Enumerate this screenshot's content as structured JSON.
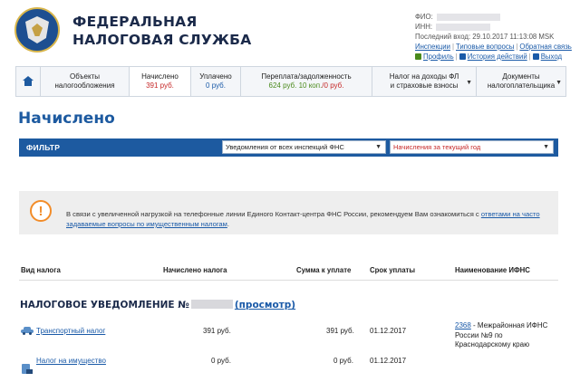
{
  "header": {
    "brand_line1": "ФЕДЕРАЛЬНАЯ",
    "brand_line2": "НАЛОГОВАЯ СЛУЖБА",
    "fio_label": "ФИО:",
    "inn_label": "ИНН:",
    "last_login": "Последний вход: 29.10.2017 11:13:08 MSK",
    "links": {
      "inspections": "Инспекции",
      "typical_questions": "Типовые вопросы",
      "feedback": "Обратная связь",
      "profile": "Профиль",
      "action_history": "История действий",
      "logout": "Выход"
    }
  },
  "tabs": [
    {
      "line1": "Объекты",
      "line2": "налогообложения"
    },
    {
      "line1": "Начислено",
      "line2": "391 руб."
    },
    {
      "line1": "Уплачено",
      "line2": "0 руб."
    },
    {
      "line1": "Переплата/задолженность",
      "line2a": "624 руб. 10 коп.",
      "line2b": "/0 руб."
    },
    {
      "line1": "Налог на доходы ФЛ",
      "line2": "и страховые взносы"
    },
    {
      "line1": "Документы",
      "line2": "налогоплательщика"
    }
  ],
  "page_title": "Начислено",
  "filter": {
    "label": "ФИЛЬТР",
    "select_inspections": "Уведомления от всех инспекций ФНС",
    "select_period": "Начисления за текущий год"
  },
  "notice": {
    "icon": "!",
    "text_before": "В связи с увеличенной нагрузкой на телефонные линии Единого Контакт-центра ФНС России, рекомендуем Вам ознакомиться с ",
    "link_text": "ответами на часто задаваемые вопросы по имущественным налогам",
    "text_after": "."
  },
  "table": {
    "columns": [
      "Вид налога",
      "Начислено налога",
      "Сумма к уплате",
      "Срок уплаты",
      "Наименование ИФНС"
    ],
    "notice_title": "НАЛОГОВОЕ УВЕДОМЛЕНИЕ №",
    "view_link": "(просмотр)",
    "rows": [
      {
        "tax": "Транспортный налог",
        "accrued": "391 руб.",
        "to_pay": "391 руб.",
        "due": "01.12.2017",
        "icon": "car-icon"
      },
      {
        "tax": "Налог на имущество",
        "accrued": "0 руб.",
        "to_pay": "0 руб.",
        "due": "01.12.2017",
        "icon": "property-icon"
      }
    ],
    "ifns_code": "2368",
    "ifns_line1": " - Межрайонная ИФНС",
    "ifns_line2": "России №9 по",
    "ifns_line3": "Краснодарскому краю"
  },
  "colors": {
    "brand_blue": "#1d5aa0",
    "link": "#1a5aa8",
    "accent_red": "#c62828",
    "overpay_green": "#4a8a1c",
    "warning_orange": "#f28c28"
  }
}
